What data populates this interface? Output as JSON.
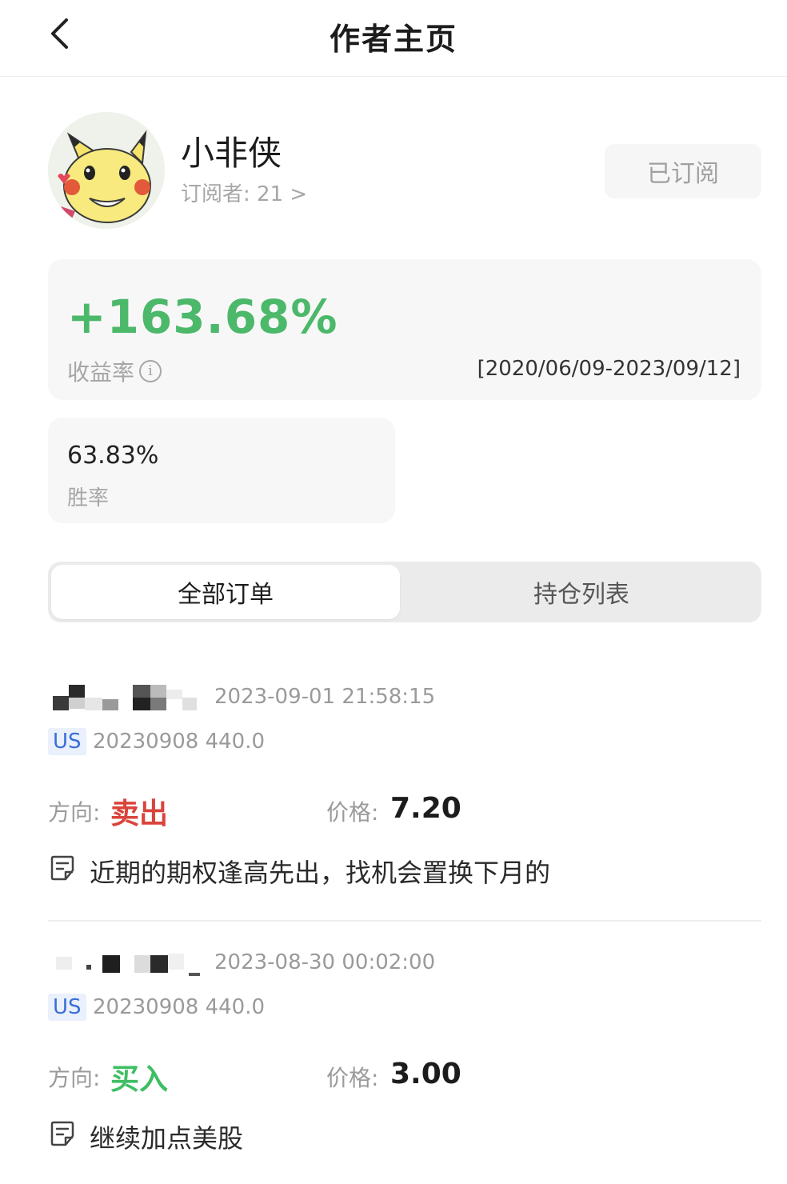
{
  "header": {
    "title": "作者主页",
    "back_icon": "chevron-left-icon"
  },
  "profile": {
    "name": "小非侠",
    "subscribers_label": "订阅者: 21 >",
    "subscribe_button": "已订阅",
    "avatar_icon": "pikachu-avatar-icon"
  },
  "performance": {
    "return_value": "+163.68%",
    "return_label": "收益率",
    "info_icon_glyph": "i",
    "date_range": "[2020/06/09-2023/09/12]",
    "win_rate_value": "63.83%",
    "win_rate_label": "胜率",
    "return_color": "#4cb86a"
  },
  "tabs": [
    {
      "label": "全部订单",
      "active": true
    },
    {
      "label": "持仓列表",
      "active": false
    }
  ],
  "orders": [
    {
      "datetime": "2023-09-01 21:58:15",
      "market": "US",
      "contract": "20230908 440.0",
      "direction_label": "方向:",
      "direction": "卖出",
      "direction_color": "#d9443b",
      "price_label": "价格:",
      "price": "7.20",
      "note": "近期的期权逢高先出，找机会置换下月的"
    },
    {
      "datetime": "2023-08-30 00:02:00",
      "market": "US",
      "contract": "20230908 440.0",
      "direction_label": "方向:",
      "direction": "买入",
      "direction_color": "#3fbe63",
      "price_label": "价格:",
      "price": "3.00",
      "note": "继续加点美股"
    }
  ]
}
